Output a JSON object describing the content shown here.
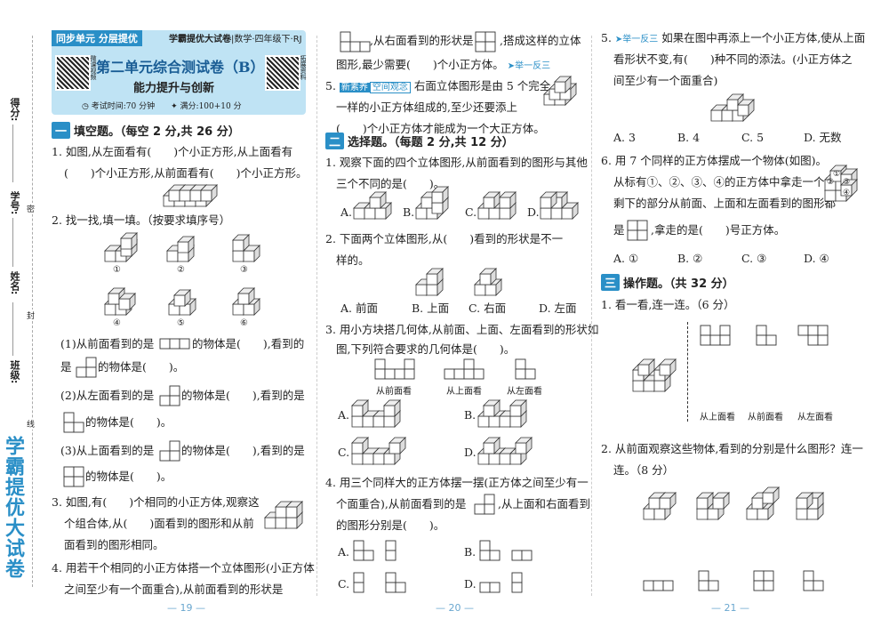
{
  "side": {
    "score": "得分:",
    "id": "学号:",
    "name": "姓名:",
    "cls": "班级:",
    "brand": "学霸提优大试卷",
    "seal1": "密",
    "seal2": "封",
    "seal3": "线"
  },
  "header": {
    "tag": "同步单元 分层提优",
    "series": "学霸提优大试卷",
    "subject": "数学·四年级下·RJ",
    "title": "第二单元综合测试卷（B）",
    "subtitle": "能力提升与创新",
    "time": "考试时间:70 分钟",
    "full": "满分:100+10 分",
    "qr1": "微课视频",
    "qr2": "拓展资料"
  },
  "sec1": {
    "tag": "一",
    "title": "填空题。（每空 2 分,共 26 分）"
  },
  "q1": {
    "a": "1. 如图,从左面看有(　　)个小正方形,从上面看有",
    "b": "(　　)个小正方形,从前面看有(　　)个小正方形。"
  },
  "q2": {
    "a": "2. 找一找,填一填。（按要求填序号）",
    "n1": "①",
    "n2": "②",
    "n3": "③",
    "n4": "④",
    "n5": "⑤",
    "n6": "⑥",
    "s1a": "(1)从前面看到的是",
    "s1b": "的物体是(　　),看到的",
    "s1c": "是",
    "s1d": "的物体是(　　)。",
    "s2a": "(2)从左面看到的是",
    "s2b": "的物体是(　　),看到的是",
    "s2c": "的物体是(　　)。",
    "s3a": "(3)从上面看到的是",
    "s3b": "的物体是(　　),看到的是",
    "s3c": "的物体是(　　)。"
  },
  "q3": {
    "a": "3. 如图,有(　　)个相同的小正方体,观察这",
    "b": "个组合体,从(　　)面看到的图形和从前",
    "c": "面看到的图形相同。"
  },
  "q4": {
    "a": "4. 用若干个相同的小正方体搭一个立体图形(小正方体",
    "b": "之间至少有一个面重合),从前面看到的形状是",
    "c": ",从右面看到的形状是",
    "d": ",搭成这样的立体",
    "e": "图形,最少需要(　　)个小正方体。",
    "f": "➤举一反三"
  },
  "q5a": {
    "a": "5.",
    "badge1": "新素养",
    "badge2": "空间观念",
    "b": "右面立体图形是由 5 个完全",
    "c": "一样的小正方体组成的,至少还要添上",
    "d": "(　　)个小正方体才能成为一个大正方体。"
  },
  "sec2": {
    "tag": "二",
    "title": "选择题。（每题 2 分,共 12 分）"
  },
  "c1": {
    "a": "1. 观察下面的四个立体图形,从前面看到的图形与其他",
    "b": "三个不同的是(　　)。",
    "A": "A.",
    "B": "B.",
    "C": "C.",
    "D": "D."
  },
  "c2": {
    "a": "2. 下面两个立体图形,从(　　)看到的形状是不一",
    "b": "样的。",
    "A": "A. 前面",
    "B": "B. 上面",
    "C": "C. 右面",
    "D": "D. 左面"
  },
  "c3": {
    "a": "3. 用小方块搭几何体,从前面、上面、左面看到的形状如",
    "b": "图,下列符合要求的几何体是(　　)。",
    "v1": "从前面看",
    "v2": "从上面看",
    "v3": "从左面看",
    "A": "A.",
    "B": "B.",
    "C": "C.",
    "D": "D."
  },
  "c4": {
    "a": "4. 用三个同样大的正方体摆一摆(正方体之间至少有一",
    "b": "个面重合),从前面看到的是",
    "c": ",从上面和右面看到",
    "d": "的图形分别是(　　)。",
    "A": "A.",
    "B": "B.",
    "C": "C.",
    "D": "D."
  },
  "c5": {
    "tag": "➤举一反三",
    "a": "5.",
    "b": "如果在图中再添上一个小正方体,使从上面",
    "c": "看形状不变,有(　　)种不同的添法。(小正方体之",
    "d": "间至少有一个面重合)",
    "A": "A. 3",
    "B": "B. 4",
    "C": "C. 5",
    "D": "D. 无数"
  },
  "c6": {
    "a": "6. 用 7 个同样的正方体摆成一个物体(如图)。",
    "b": "从标有①、②、③、④的正方体中拿走一个后,",
    "c": "剩下的部分从前面、上面和左面看到的图形都",
    "d": "是",
    "e": ",拿走的是(　　)号正方体。",
    "A": "A. ①",
    "B": "B. ②",
    "C": "C. ③",
    "D": "D. ④",
    "m1": "①",
    "m2": "②",
    "m3": "③",
    "m4": "④"
  },
  "sec3": {
    "tag": "三",
    "title": "操作题。（共 32 分）"
  },
  "o1": {
    "a": "1. 看一看,连一连。（6 分）",
    "l1": "从上面看",
    "l2": "从前面看",
    "l3": "从左面看"
  },
  "o2": {
    "a": "2. 从前面观察这些物体,看到的分别是什么图形？连一",
    "b": "连。（8 分）"
  },
  "pages": {
    "p1": "— 19 —",
    "p2": "— 20 —",
    "p3": "— 21 —"
  }
}
